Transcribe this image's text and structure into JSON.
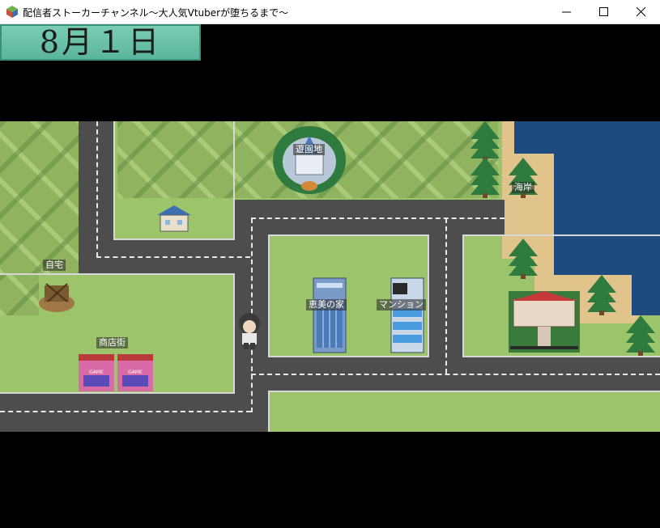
{
  "window": {
    "title": "配信者ストーカーチャンネル～大人気Vtuberが堕ちるまで～",
    "minimize_icon": "minimize-icon",
    "maximize_icon": "maximize-icon",
    "close_icon": "close-icon"
  },
  "hud": {
    "date": "8月１日"
  },
  "map": {
    "locations": {
      "amusement_park": "遊園地",
      "coast": "海岸",
      "home": "自宅",
      "emi_house": "恵美の家",
      "mansion": "マンション",
      "shopping_street": "商店街"
    },
    "shop_sign": "GAME"
  },
  "colors": {
    "grass": "#9cc46a",
    "road": "#4d4d4d",
    "sea": "#1f4a7e",
    "sand": "#e0c48c",
    "date_box": "#6cc2a8"
  }
}
